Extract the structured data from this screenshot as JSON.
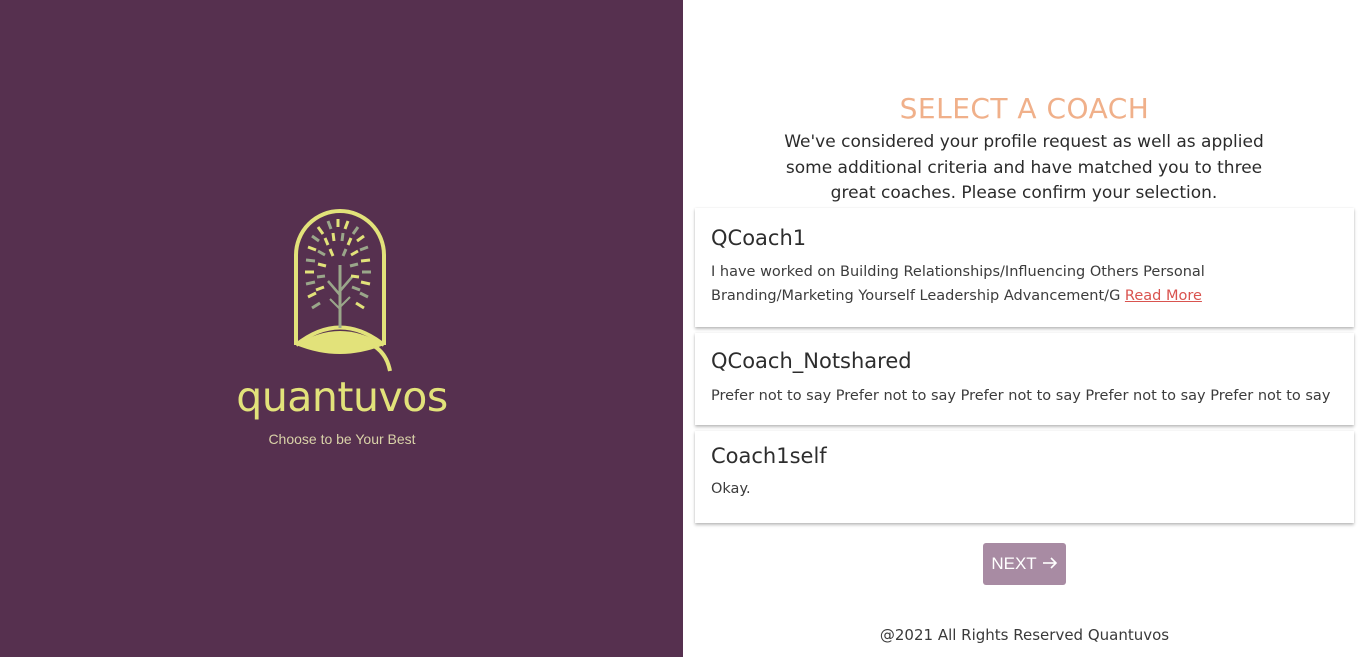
{
  "brand": {
    "name": "quantuvos",
    "tagline": "Choose to be Your Best",
    "background_color": "#56304f",
    "logo_color": "#e2e27a",
    "logo_icon": "tree-in-q-logo-icon"
  },
  "main": {
    "heading": "SELECT A COACH",
    "heading_color": "#f0b08a",
    "intro": "We've considered your profile request as well as applied some additional criteria and have matched you to three great coaches. Please confirm your selection.",
    "coaches": [
      {
        "name": "QCoach1",
        "description": "I have worked on Building Relationships/Influencing Others Personal Branding/Marketing Yourself Leadership Advancement/G",
        "read_more": "Read More"
      },
      {
        "name": "QCoach_Notshared",
        "description": "Prefer not to say Prefer not to say Prefer not to say Prefer not to say Prefer not to say"
      },
      {
        "name": "Coach1self",
        "description": "Okay."
      }
    ],
    "next_button": {
      "label": "NEXT",
      "icon": "arrow-right-icon",
      "color": "#a88ba3"
    },
    "footer": "@2021 All Rights Reserved Quantuvos"
  }
}
